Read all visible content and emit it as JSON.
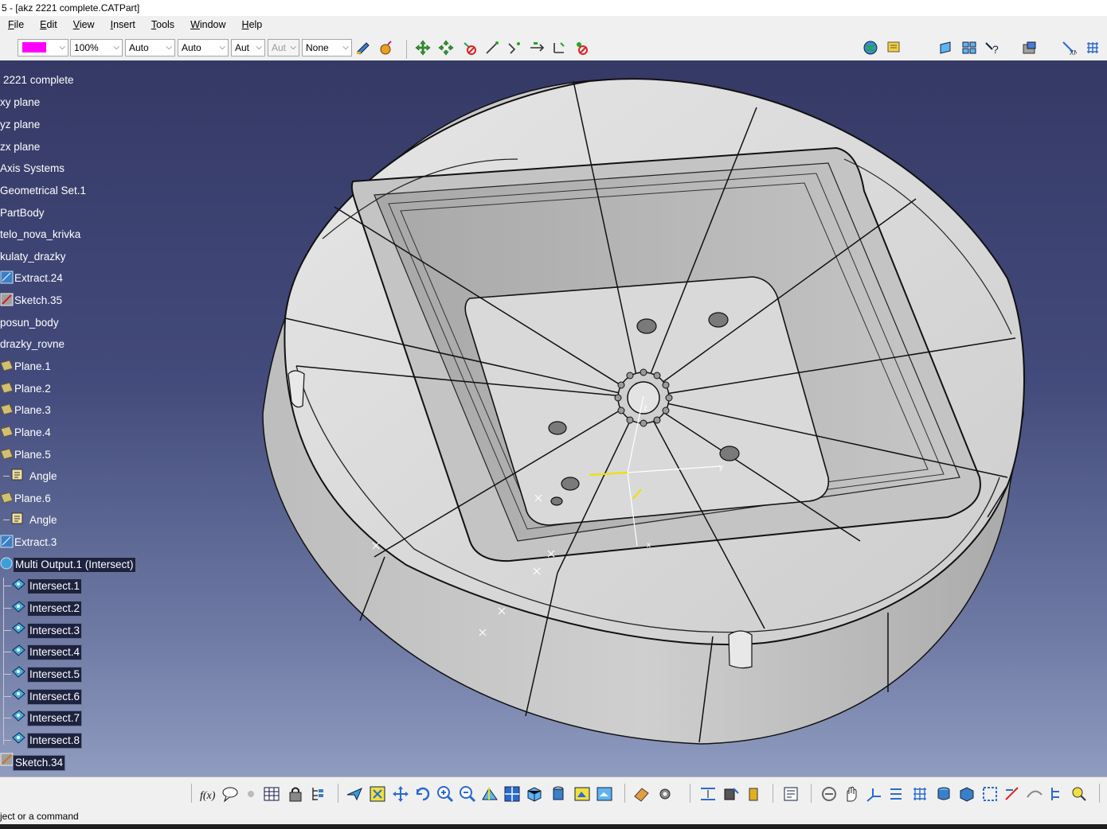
{
  "window": {
    "title": "5 - [akz 2221 complete.CATPart]"
  },
  "menu": [
    "File",
    "Edit",
    "View",
    "Insert",
    "Tools",
    "Window",
    "Help"
  ],
  "toolbar": {
    "color_swatch": "#ff00ff",
    "transparency": "100%",
    "linetype": "Auto",
    "thickness": "Auto",
    "point_symbol": "Aut",
    "layer_disabled": "Aut",
    "render_style": "None"
  },
  "tree": {
    "root": "2221 complete",
    "items": [
      {
        "label": "xy plane"
      },
      {
        "label": "yz plane"
      },
      {
        "label": "zx plane"
      },
      {
        "label": "Axis Systems"
      },
      {
        "label": "Geometrical Set.1"
      },
      {
        "label": "PartBody"
      },
      {
        "label": "telo_nova_krivka"
      },
      {
        "label": "kulaty_drazky"
      },
      {
        "label": "Extract.24"
      },
      {
        "label": "Sketch.35"
      },
      {
        "label": "posun_body"
      },
      {
        "label": "drazky_rovne"
      },
      {
        "label": "Plane.1"
      },
      {
        "label": "Plane.2"
      },
      {
        "label": "Plane.3"
      },
      {
        "label": "Plane.4"
      },
      {
        "label": "Plane.5"
      },
      {
        "label": "Angle"
      },
      {
        "label": "Plane.6"
      },
      {
        "label": "Angle"
      },
      {
        "label": "Extract.3"
      },
      {
        "label": "Multi Output.1 (Intersect)"
      },
      {
        "label": "Intersect.1"
      },
      {
        "label": "Intersect.2"
      },
      {
        "label": "Intersect.3"
      },
      {
        "label": "Intersect.4"
      },
      {
        "label": "Intersect.5"
      },
      {
        "label": "Intersect.6"
      },
      {
        "label": "Intersect.7"
      },
      {
        "label": "Intersect.8"
      },
      {
        "label": "Sketch.34"
      }
    ]
  },
  "compass": {
    "x_label": "x",
    "y_label": "y",
    "z_label": "z"
  },
  "status": {
    "prompt": "ject or a command"
  },
  "colors": {
    "viewport_top": "#353965",
    "viewport_bottom": "#8f9bbf",
    "part_surface": "#d8d8d8",
    "selected_node_bg": "#1d223f"
  }
}
